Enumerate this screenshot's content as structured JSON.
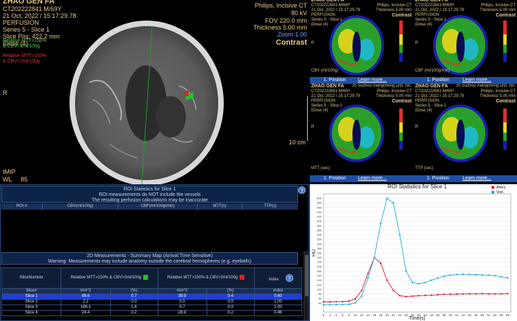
{
  "viewer": {
    "patient_name": "ZHAO GEN FA",
    "patient_id": "CT202222841 M/69Y",
    "datetime": "21 Oct, 2022 / 15:17:29.78",
    "protocol": "PERFUSION",
    "series": "Series 5 - Slice 1",
    "slice_pos": "Slice Pos: 422.2 mm",
    "dose": "iDose (4)",
    "legend_green": "Relative MTT>150% & CBV>2ml/100g",
    "legend_red": "Relative MTT>150% & CBV<2ml/100g",
    "scanner": "Philips, Incisive CT",
    "kv": "80 kV",
    "fov": "FOV 220.0 mm",
    "thickness": "Thickness 5.00 mm",
    "zoom": "Zoom 1.00",
    "contrast": "Contrast",
    "orient_r": "R",
    "scale": "10 cm",
    "tmip": "tMIP",
    "wl_label": "WL",
    "wl_value": "85"
  },
  "thumbs": [
    {
      "id": "cbv",
      "name": "ZHAO GEN FA",
      "pid": "CT202222841 M/69Y",
      "date": "21 Oct, 2022 / 15:17:29.78",
      "proto": "PERFUSION",
      "series": "Series 5 - Slice 1",
      "dose": "iDose (4)",
      "hosp": "",
      "scanner": "Philips, Incisive CT",
      "thick": "Thickness 5.00 mm",
      "contrast": "Contrast",
      "map": "CBV (ml/100g)",
      "orient": "R"
    },
    {
      "id": "cbf",
      "name": "ZHAO GEN FA",
      "pid": "CT202222841 M/69Y",
      "date": "21 Oct, 2022 / 15:17:29.78",
      "proto": "PERFUSION",
      "series": "Series 5 - Slice 1",
      "dose": "iDose (4)",
      "hosp": "",
      "scanner": "Philips, Incisive CT",
      "thick": "Thickness 5.00 mm",
      "contrast": "Contrast",
      "map": "CBF (ml/100g/min)",
      "orient": "R"
    },
    {
      "id": "mtt",
      "name": "ZHAO GEN FA",
      "pid": "CT202222841 M/69Y",
      "date": "21 Oct, 2022 / 15:17:29.78",
      "proto": "PERFUSION",
      "series": "Series 5 - Slice 1",
      "dose": "iDose (4)",
      "hosp": "JS Suzhou Xiangcheng Dist. No.",
      "scanner": "Philips, Incisive CT",
      "thick": "Thickness 5.00 mm",
      "contrast": "Contrast",
      "map": "MTT (sec)",
      "orient": "R"
    },
    {
      "id": "ttp",
      "name": "ZHAO GEN FA",
      "pid": "CT202222841 M/69Y",
      "date": "21 Oct, 2022 / 15:17:29.78",
      "proto": "PERFUSION",
      "series": "Series 5 - Slice 1",
      "dose": "iDose (4)",
      "hosp": "JS Suzhou Xiangcheng Dist. No.",
      "scanner": "Philips, Incisive CT",
      "thick": "Thickness 5.00 mm",
      "contrast": "Contrast",
      "map": "TTP (sec)",
      "orient": "R"
    }
  ],
  "position_bar": {
    "label": "1. Position",
    "link": "Learn more..."
  },
  "roi_table": {
    "title": "ROI Statistics for Slice 1",
    "subtitle1": "ROI measurements do NOT include the vessels",
    "subtitle2": "The resulting perfusion calculations may be inaccurate",
    "columns": [
      "ROI #",
      "CBV(ml/100g)",
      "CBF(ml/100g/min)",
      "MTT(s)",
      "TTP(s)"
    ]
  },
  "summary_table": {
    "title": "2D Measurements - Summary Map (Arrival Time Sensitive)",
    "warning": "Warning: Measurements may include anatomy outside the cerebral hemispheres (e.g. eyeballs)",
    "headers": {
      "slice": "SliceNumber",
      "green": "Relative MTT>150% & CBV>2ml/100g",
      "red": "Relative MTT>150% & CBV<2ml/100g",
      "index": "Index"
    },
    "units": [
      "Slice#",
      "mm^2",
      "(%)",
      "mm^2",
      "(%)",
      "Index"
    ],
    "rows": [
      {
        "slice": "Slice 1",
        "g_mm": "69.6",
        "g_pct": "0.7",
        "r_mm": "39.9",
        "r_pct": "0.4",
        "index": "0.60",
        "selected": true
      },
      {
        "slice": "Slice 2",
        "g_mm": "2.2",
        "g_pct": "0.0",
        "r_mm": "0.0",
        "r_pct": "0.0",
        "index": "1.00",
        "selected": false
      },
      {
        "slice": "Slice 3",
        "g_mm": "186.1",
        "g_pct": "1.6",
        "r_mm": "0.7",
        "r_pct": "0.0",
        "index": "1.00",
        "selected": false
      },
      {
        "slice": "Slice 4",
        "g_mm": "24.4",
        "g_pct": "0.2",
        "r_mm": "28.9",
        "r_pct": "0.2",
        "index": "0.46",
        "selected": false
      }
    ]
  },
  "colors": {
    "green": "#22c22a",
    "red": "#e02020",
    "artery": "#e0102a",
    "vein": "#19a9d8"
  },
  "chart_data": {
    "type": "line",
    "title": "ROI Statistics for Slice 1",
    "xlabel": "Time(s)",
    "ylabel": "HU",
    "xlim": [
      0,
      59
    ],
    "ylim": [
      0,
      520
    ],
    "xticks": [
      0,
      2,
      4,
      6,
      8,
      10,
      12,
      14,
      16,
      18,
      20,
      22,
      24,
      26,
      28,
      30,
      32,
      34,
      36,
      38,
      40,
      42,
      44,
      46,
      48,
      50,
      52,
      54,
      56,
      58
    ],
    "yticks": [
      40,
      60,
      80,
      100,
      120,
      140,
      160,
      180,
      200,
      220,
      240,
      260,
      280,
      300,
      320,
      340,
      360,
      380,
      400,
      420,
      440,
      460,
      480,
      500
    ],
    "legend": "top-right",
    "series": [
      {
        "name": "Artery",
        "color": "#e0102a",
        "x": [
          0,
          2,
          4,
          6,
          8,
          10,
          12,
          14,
          16,
          18,
          20,
          22,
          24,
          26,
          28,
          30,
          32,
          34,
          36,
          38,
          40,
          42,
          44,
          46,
          48,
          50,
          52,
          54,
          56,
          58
        ],
        "y": [
          45,
          45,
          46,
          46,
          48,
          58,
          95,
          170,
          240,
          215,
          140,
          95,
          72,
          68,
          70,
          72,
          73,
          74,
          76,
          78,
          78,
          79,
          80,
          80,
          80,
          81,
          80,
          80,
          80,
          81
        ]
      },
      {
        "name": "Vein",
        "color": "#19a9d8",
        "x": [
          0,
          2,
          4,
          6,
          8,
          10,
          12,
          14,
          16,
          18,
          20,
          22,
          24,
          26,
          28,
          30,
          32,
          34,
          36,
          38,
          40,
          42,
          44,
          46,
          48,
          50,
          52,
          54,
          56,
          58
        ],
        "y": [
          32,
          32,
          33,
          33,
          34,
          40,
          70,
          150,
          240,
          390,
          500,
          480,
          340,
          180,
          130,
          125,
          130,
          140,
          150,
          158,
          162,
          165,
          166,
          165,
          164,
          163,
          162,
          160,
          155,
          150
        ]
      }
    ]
  }
}
